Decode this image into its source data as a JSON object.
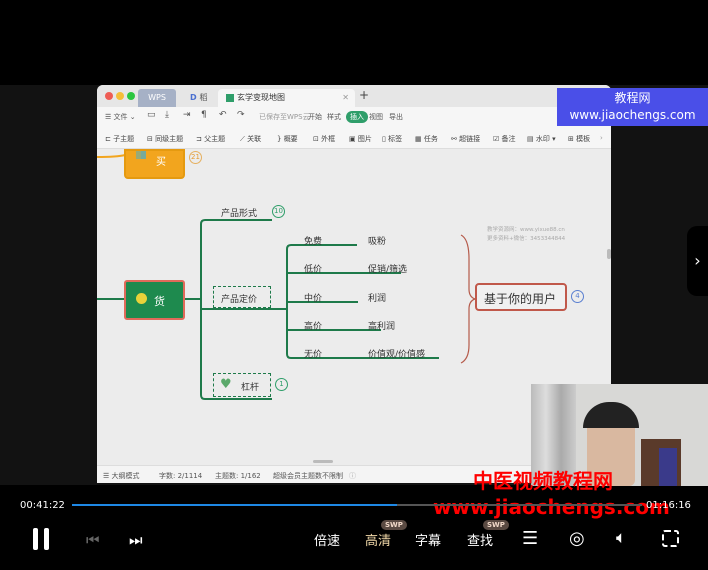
{
  "window": {
    "tabs": [
      {
        "label": "WPS"
      },
      {
        "label": "稻壳"
      },
      {
        "label": "玄学变现地图",
        "active": true
      }
    ],
    "new_tab": "+"
  },
  "menubar": {
    "file": "☰ 文件 ⌄",
    "saved_status": "已保存至WPS云",
    "items": [
      "开始",
      "样式",
      "插入",
      "视图",
      "导出"
    ]
  },
  "toolbar": {
    "items": [
      "子主题",
      "同级主题",
      "父主题",
      "关联",
      "概要",
      "外框",
      "图片",
      "标签",
      "任务",
      "超链接",
      "备注",
      "水印 ▾",
      "模板"
    ]
  },
  "mindmap": {
    "nodes": {
      "buy": {
        "label": "买",
        "badge": "21"
      },
      "goods": {
        "label": "货"
      },
      "product_form": {
        "label": "产品形式",
        "badge": "10"
      },
      "pricing": {
        "label": "产品定价"
      },
      "leverage": {
        "label": "杠杆",
        "badge": "1"
      },
      "based_on_user": {
        "label": "基于你的用户",
        "badge": "4"
      }
    },
    "pricing_rows": [
      {
        "tier": "免费",
        "purpose": "吸粉"
      },
      {
        "tier": "低价",
        "purpose": "促销/筛选"
      },
      {
        "tier": "中价",
        "purpose": "利润"
      },
      {
        "tier": "高价",
        "purpose": "高利润"
      },
      {
        "tier": "无价",
        "purpose": "价值观/价值感"
      }
    ],
    "faint_note_line1": "教学资源网：www.yixue88.cn",
    "faint_note_line2": "更多资料+微信：3453344844"
  },
  "statusbar": {
    "outline_mode": "大纲模式",
    "word_count": "字数: 2/1114",
    "topic_count": "主题数: 1/162",
    "member_note": "超级会员主题数不限制"
  },
  "watermarks": {
    "top_right_line1": "教程网",
    "top_right_line2": "www.jiaochengs.com",
    "red_line1": "中医视频教程网",
    "red_line2": "www.jiaochengs.com"
  },
  "player": {
    "current_time": "00:41:22",
    "total_time": "01:16:16",
    "progress": 0.57,
    "speed": "倍速",
    "quality": "高清",
    "subtitles": "字幕",
    "search": "查找",
    "swp_badge": "SWP",
    "accent_color": "#1e88e5"
  }
}
